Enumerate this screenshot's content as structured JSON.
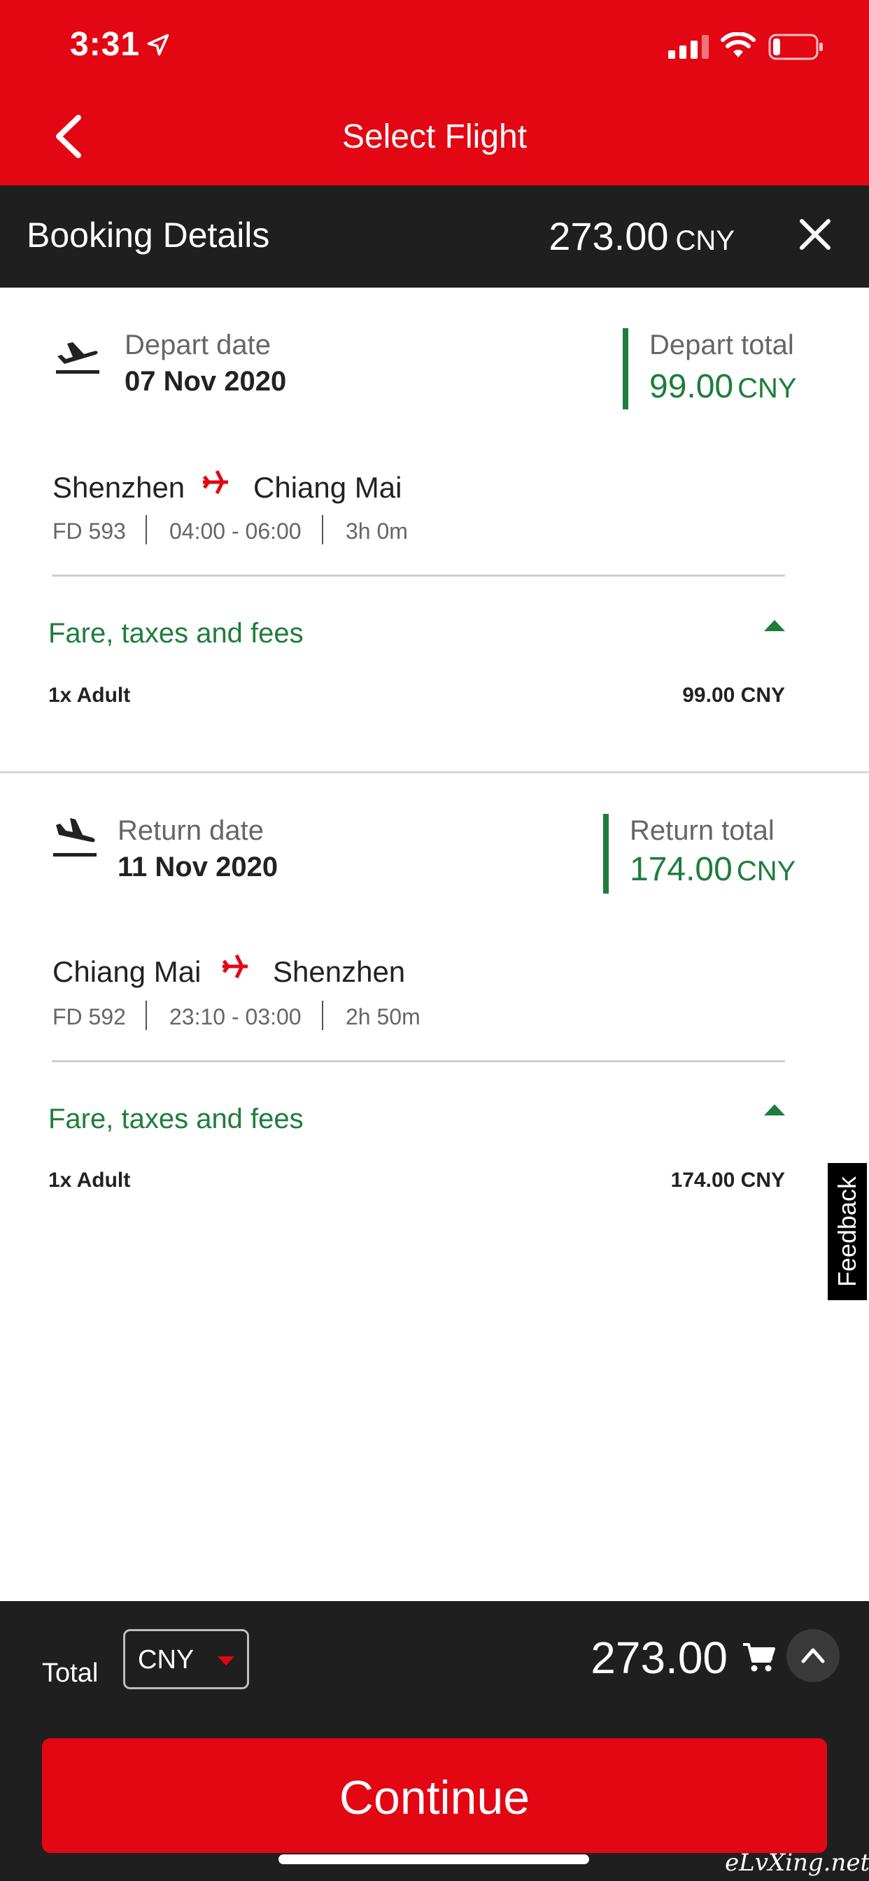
{
  "status_bar": {
    "time": "3:31"
  },
  "header": {
    "title": "Select Flight"
  },
  "booking": {
    "title": "Booking Details",
    "total": "273.00",
    "currency": "CNY"
  },
  "depart": {
    "date_label": "Depart date",
    "date_value": "07 Nov 2020",
    "total_label": "Depart total",
    "total_amount": "99.00",
    "total_currency": "CNY",
    "origin": "Shenzhen",
    "destination": "Chiang Mai",
    "flight_no": "FD 593",
    "time": "04:00 - 06:00",
    "duration": "3h 0m",
    "fare_label": "Fare, taxes and fees",
    "pax_label": "1x Adult",
    "pax_amount": "99.00 CNY"
  },
  "return": {
    "date_label": "Return date",
    "date_value": "11 Nov 2020",
    "total_label": "Return total",
    "total_amount": "174.00",
    "total_currency": "CNY",
    "origin": "Chiang Mai",
    "destination": "Shenzhen",
    "flight_no": "FD 592",
    "time": "23:10 - 03:00",
    "duration": "2h 50m",
    "fare_label": "Fare, taxes and fees",
    "pax_label": "1x Adult",
    "pax_amount": "174.00 CNY"
  },
  "feedback": {
    "label": "Feedback"
  },
  "footer": {
    "total_label": "Total",
    "currency_selected": "CNY",
    "grand_total": "273.00",
    "continue_label": "Continue",
    "watermark": "eLvXing.net"
  },
  "colors": {
    "brand_red": "#e30613",
    "dark_bar": "#1f1f1f",
    "accent_green": "#1e7d3c"
  }
}
